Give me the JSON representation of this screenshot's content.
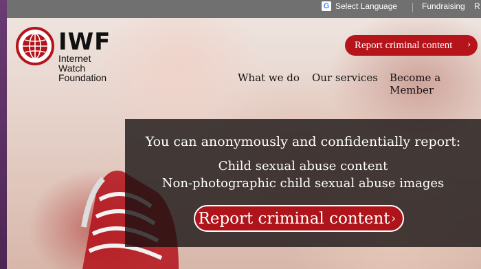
{
  "topbar": {
    "language_label": "Select Language",
    "fundraising_label": "Fundraising",
    "cutoff_label": "R"
  },
  "logo": {
    "abbrev": "IWF",
    "line1": "Internet",
    "line2": "Watch",
    "line3": "Foundation"
  },
  "header": {
    "report_button_label": "Report criminal content"
  },
  "nav": {
    "items": [
      "What we do",
      "Our services",
      "Become a Member"
    ]
  },
  "hero": {
    "intro": "You can anonymously and confidentially report:",
    "item1": "Child sexual abuse content",
    "item2": "Non-photographic child sexual abuse images",
    "report_button_label": "Report criminal content"
  },
  "colors": {
    "brand_red": "#b4141a",
    "topbar_gray": "#707071"
  }
}
